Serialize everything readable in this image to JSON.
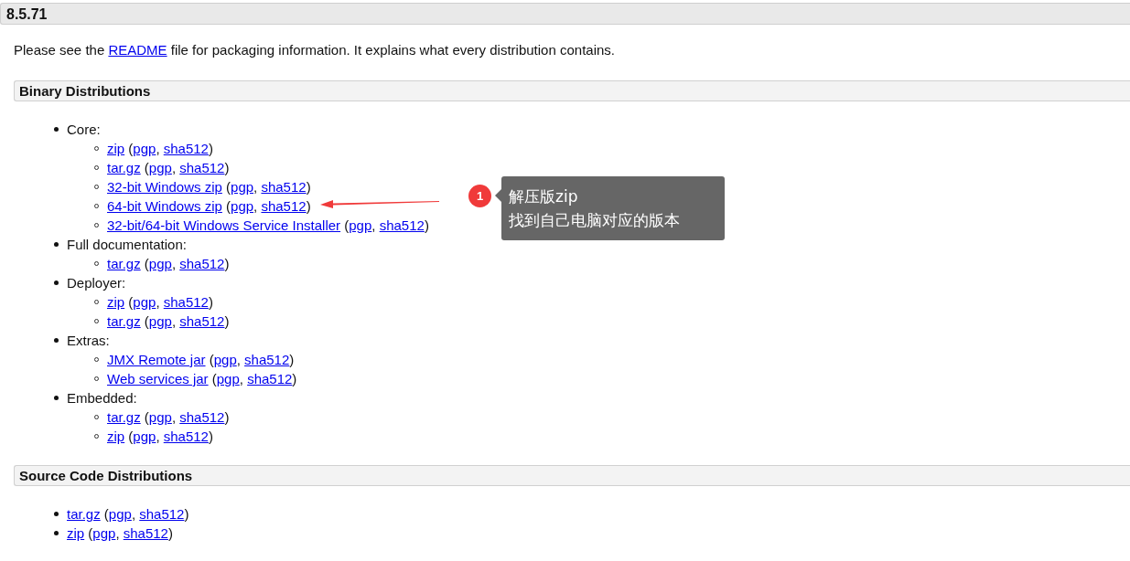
{
  "version_title": "8.5.71",
  "intro": {
    "before": "Please see the ",
    "link": "README",
    "after": " file for packaging information. It explains what every distribution contains."
  },
  "sections": [
    {
      "title": "Binary Distributions",
      "groups": [
        {
          "label": "Core:",
          "files": [
            {
              "name": "zip",
              "open": "(",
              "pgp": "pgp",
              "sep": ",",
              "sha": "sha512",
              "close": ")"
            },
            {
              "name": "tar.gz",
              "open": "(",
              "pgp": "pgp",
              "sep": ",",
              "sha": "sha512",
              "close": ")"
            },
            {
              "name": "32-bit Windows zip",
              "open": "(",
              "pgp": "pgp",
              "sep": ",",
              "sha": "sha512",
              "close": ")"
            },
            {
              "name": "64-bit Windows zip",
              "open": "(",
              "pgp": "pgp",
              "sep": ",",
              "sha": "sha512",
              "close": ")"
            },
            {
              "name": "32-bit/64-bit Windows Service Installer",
              "open": "(",
              "pgp": "pgp",
              "sep": ",",
              "sha": "sha512",
              "close": ")"
            }
          ]
        },
        {
          "label": "Full documentation:",
          "files": [
            {
              "name": "tar.gz",
              "open": "(",
              "pgp": "pgp",
              "sep": ",",
              "sha": "sha512",
              "close": ")"
            }
          ]
        },
        {
          "label": "Deployer:",
          "files": [
            {
              "name": "zip",
              "open": "(",
              "pgp": "pgp",
              "sep": ",",
              "sha": "sha512",
              "close": ")"
            },
            {
              "name": "tar.gz",
              "open": "(",
              "pgp": "pgp",
              "sep": ",",
              "sha": "sha512",
              "close": ")"
            }
          ]
        },
        {
          "label": "Extras:",
          "files": [
            {
              "name": "JMX Remote jar",
              "open": "(",
              "pgp": "pgp",
              "sep": ",",
              "sha": "sha512",
              "close": ")"
            },
            {
              "name": "Web services jar",
              "open": "(",
              "pgp": "pgp",
              "sep": ",",
              "sha": "sha512",
              "close": ")"
            }
          ]
        },
        {
          "label": "Embedded:",
          "files": [
            {
              "name": "tar.gz",
              "open": "(",
              "pgp": "pgp",
              "sep": ",",
              "sha": "sha512",
              "close": ")"
            },
            {
              "name": "zip",
              "open": "(",
              "pgp": "pgp",
              "sep": ",",
              "sha": "sha512",
              "close": ")"
            }
          ]
        }
      ]
    },
    {
      "title": "Source Code Distributions",
      "files": [
        {
          "name": "tar.gz",
          "open": "(",
          "pgp": "pgp",
          "sep": ",",
          "sha": "sha512",
          "close": ")"
        },
        {
          "name": "zip",
          "open": "(",
          "pgp": "pgp",
          "sep": ",",
          "sha": "sha512",
          "close": ")"
        }
      ]
    }
  ],
  "annotation": {
    "number": "1",
    "lines": [
      "解压版zip",
      "找到自己电脑对应的版本"
    ]
  }
}
